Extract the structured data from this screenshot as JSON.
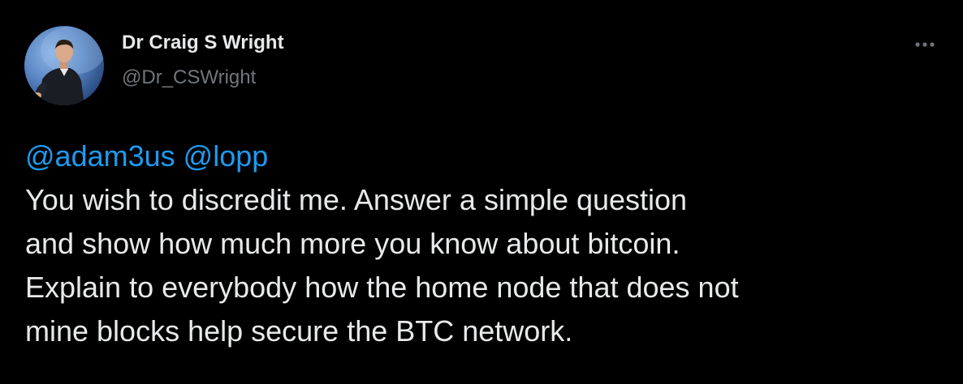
{
  "author": {
    "display_name": "Dr Craig S Wright",
    "handle": "@Dr_CSWright",
    "avatar_icon": "profile-photo"
  },
  "menu": {
    "icon": "more-options-icon"
  },
  "tweet": {
    "mentions": [
      "@adam3us",
      "@lopp"
    ],
    "lines": [
      "You wish to discredit me. Answer a simple question",
      "and show how much more you know about bitcoin.",
      "Explain to everybody how the home node that does not",
      "mine blocks help secure the BTC network."
    ]
  },
  "colors": {
    "background": "#000000",
    "text": "#e7e9ea",
    "secondary": "#71767b",
    "link": "#1d9bf0"
  }
}
